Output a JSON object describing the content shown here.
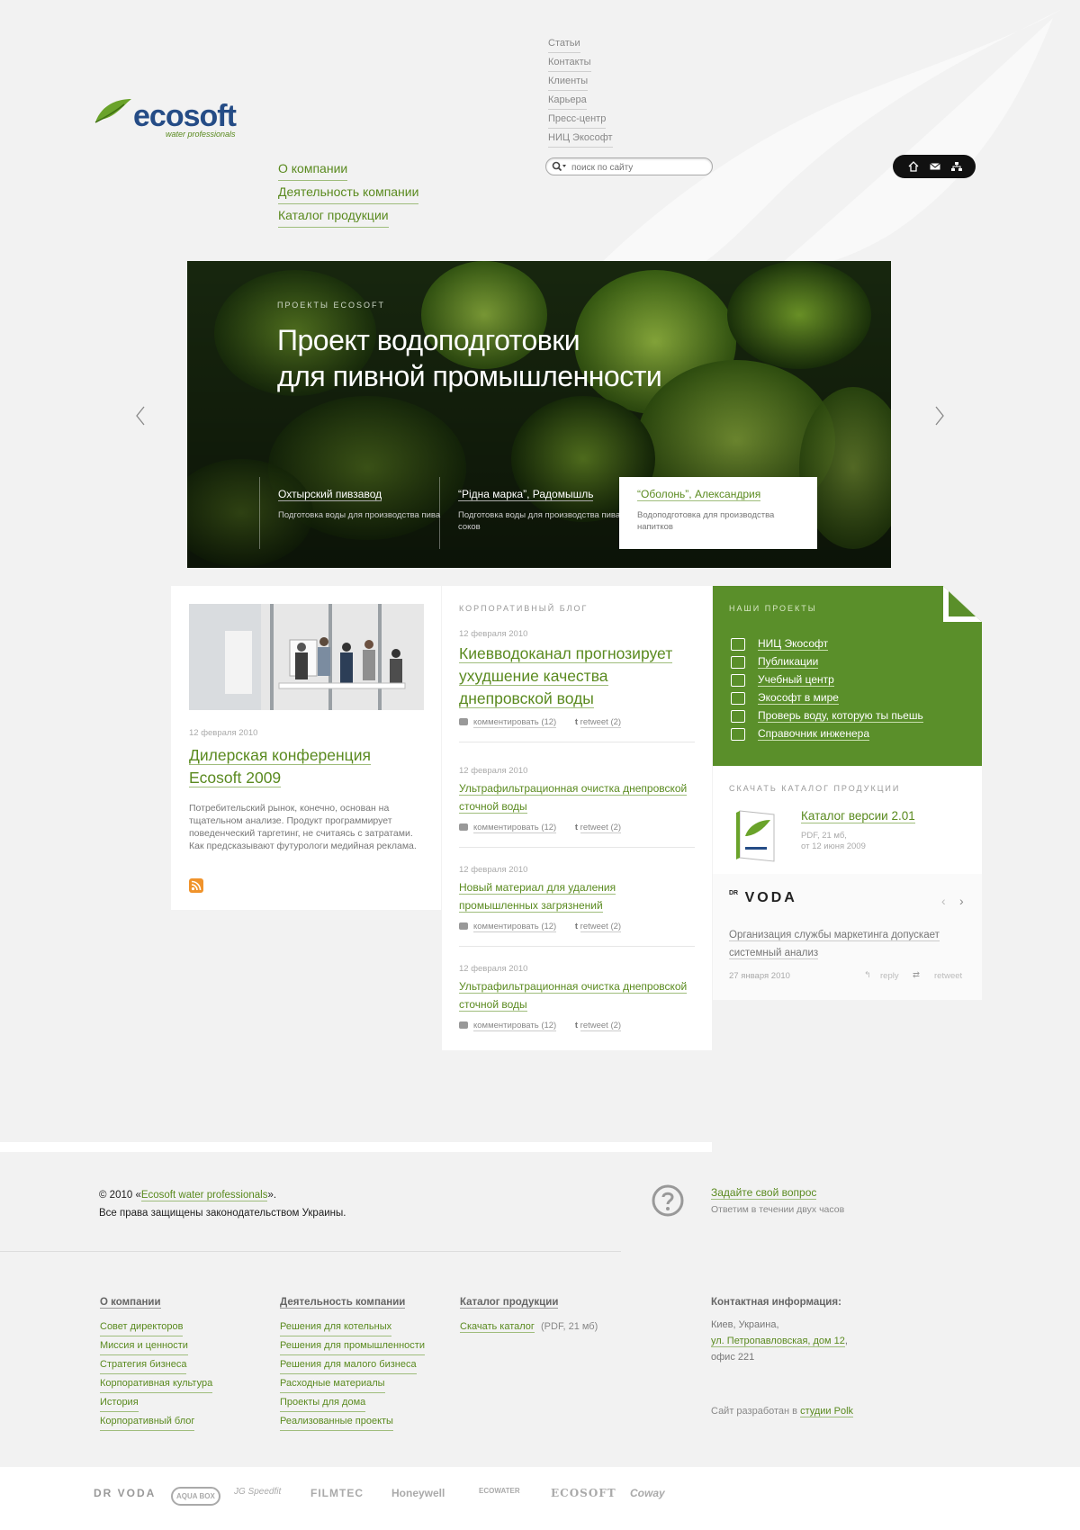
{
  "colors": {
    "accent": "#5a8a1f",
    "green_panel": "#5a8f2a",
    "logo_blue": "#254c86",
    "background": "#f2f2f2"
  },
  "logo": {
    "word": "ecosoft",
    "tagline": "water professionals"
  },
  "top_links": [
    "Статьи",
    "Контакты",
    "Клиенты",
    "Карьера",
    "Пресс-центр",
    "НИЦ Экософт"
  ],
  "main_nav": [
    "О компании",
    "Деятельность компании",
    "Каталог продукции"
  ],
  "search": {
    "placeholder": "поиск по сайту"
  },
  "header_icons": [
    "home-icon",
    "mail-icon",
    "sitemap-icon"
  ],
  "hero": {
    "kicker": "ПРОЕКТЫ ECOSOFT",
    "title_line1": "Проект водоподготовки",
    "title_line2": "для пивной промышленности",
    "cards": [
      {
        "title": "Охтырский пивзавод",
        "desc": "Подготовка воды для производства пива"
      },
      {
        "title": "“Рідна марка”, Радомышль",
        "desc": "Подготовка воды для производства пива и соков"
      },
      {
        "title": "“Оболонь”, Александрия",
        "desc": "Водоподготовка для производства напитков"
      }
    ]
  },
  "left_panel": {
    "date": "12 февраля 2010",
    "title_line1": "Дилерская конференция",
    "title_line2": "Ecosoft 2009",
    "text": "Потребительский рынок, конечно, основан на тщательном анализе. Продукт программирует поведенческий таргетинг, не считаясь с затратами. Как предсказывают футурологи медийная реклама."
  },
  "blog": {
    "kicker": "КОРПОРАТИВНЫЙ БЛОГ",
    "comment_label": "комментировать (12)",
    "retweet_label": "retweet (2)",
    "posts": [
      {
        "date": "12 февраля 2010",
        "line1": "Киевводоканал прогнозирует",
        "line2": "ухудшение качества",
        "line3": "днепровской воды"
      },
      {
        "date": "12 февраля 2010",
        "line1": "Ультрафильтрационная очистка днепровской",
        "line2": "сточной воды"
      },
      {
        "date": "12 февраля 2010",
        "line1": "Новый материал для удаления",
        "line2": "промышленных загрязнений"
      },
      {
        "date": "12 февраля 2010",
        "line1": "Ультрафильтрационная очистка днепровской",
        "line2": "сточной воды"
      }
    ]
  },
  "projects": {
    "kicker": "НАШИ ПРОЕКТЫ",
    "items": [
      "НИЦ Экософт",
      "Публикации",
      "Учебный центр",
      "Экософт в мире",
      "Проверь воду, которую ты пьешь",
      "Справочник инженера"
    ]
  },
  "catalog": {
    "kicker": "СКАЧАТЬ КАТАЛОГ ПРОДУКЦИИ",
    "title": "Каталог версии 2.01",
    "meta1": "PDF, 21 мб,",
    "meta2": "от 12 июня 2009"
  },
  "drvoda": {
    "logo": "VODA",
    "logo_prefix": "DR",
    "line1": "Организация службы маркетинга допускает",
    "line2": "системный анализ",
    "date": "27 января 2010",
    "reply": "reply",
    "retweet": "retweet"
  },
  "footer": {
    "copy_prefix": "© 2010 «",
    "copy_link": "Ecosoft water professionals",
    "copy_suffix": "».",
    "rights": "Все права защищены законодательством Украины.",
    "ask_title": "Задайте свой вопрос",
    "ask_sub": "Ответим в течении двух часов",
    "col1": {
      "title": "О компании",
      "items": [
        "Совет директоров",
        "Миссия и ценности",
        "Стратегия бизнеса",
        "Корпоративная культура",
        "История",
        "Корпоративный блог"
      ]
    },
    "col2": {
      "title": "Деятельность компании",
      "items": [
        "Решения для котельных",
        "Решения для промышленности",
        "Решения для малого бизнеса",
        "Расходные материалы",
        "Проекты для дома",
        "Реализованные проекты"
      ]
    },
    "col3": {
      "title": "Каталог продукции",
      "download": "Скачать каталог",
      "download_meta": "(PDF, 21 мб)"
    },
    "contact": {
      "title": "Контактная информация:",
      "city": "Киев, Украина,",
      "street": "ул. Петропавловская, дом 12",
      "office": "офис 221"
    },
    "credit_prefix": "Сайт разработан в ",
    "credit_link": "студии Polk"
  },
  "brands": [
    "DR VODA",
    "AQUA BOX",
    "JG Speedfit",
    "FILMTEC",
    "Honeywell",
    "ECOWATER",
    "ECOSOFT",
    "Coway"
  ]
}
